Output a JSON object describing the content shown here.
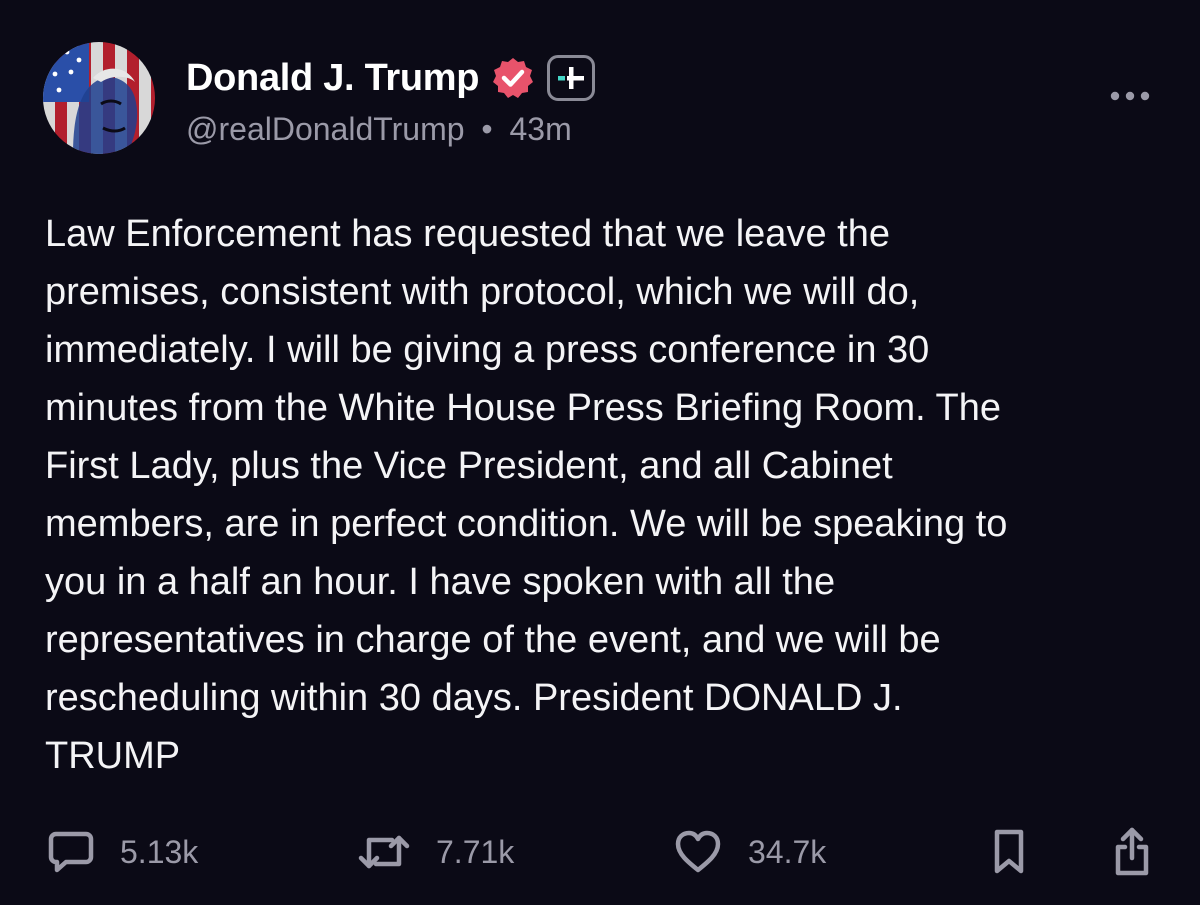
{
  "post": {
    "author_name": "Donald J. Trump",
    "handle": "@realDonaldTrump",
    "separator": "•",
    "time_ago": "43m",
    "text": "Law Enforcement has requested that we leave the\npremises, consistent with protocol, which we will do,\nimmediately. I will be giving a press conference in 30\nminutes from the White House Press Briefing Room. The\nFirst Lady, plus the Vice President, and all Cabinet\nmembers, are in perfect condition. We will be speaking to\nyou in a half an hour. I have spoken with all the\nrepresentatives in charge of the event, and we will be\nrescheduling within 30 days. President DONALD J.\nTRUMP"
  },
  "actions": {
    "replies": "5.13k",
    "retruths": "7.71k",
    "likes": "34.7k"
  },
  "icons": {
    "verified": "verified-badge-icon",
    "follow": "follow-plus-icon",
    "more": "more-dots-icon",
    "reply": "reply-bubble-icon",
    "retruth": "retruth-arrows-icon",
    "like": "heart-icon",
    "bookmark": "bookmark-icon",
    "share": "share-icon"
  },
  "colors": {
    "background": "#0b0a16",
    "verified_badge": "#e8536b",
    "follow_accent": "#45d7c8",
    "muted_text": "#9b9aa8"
  }
}
